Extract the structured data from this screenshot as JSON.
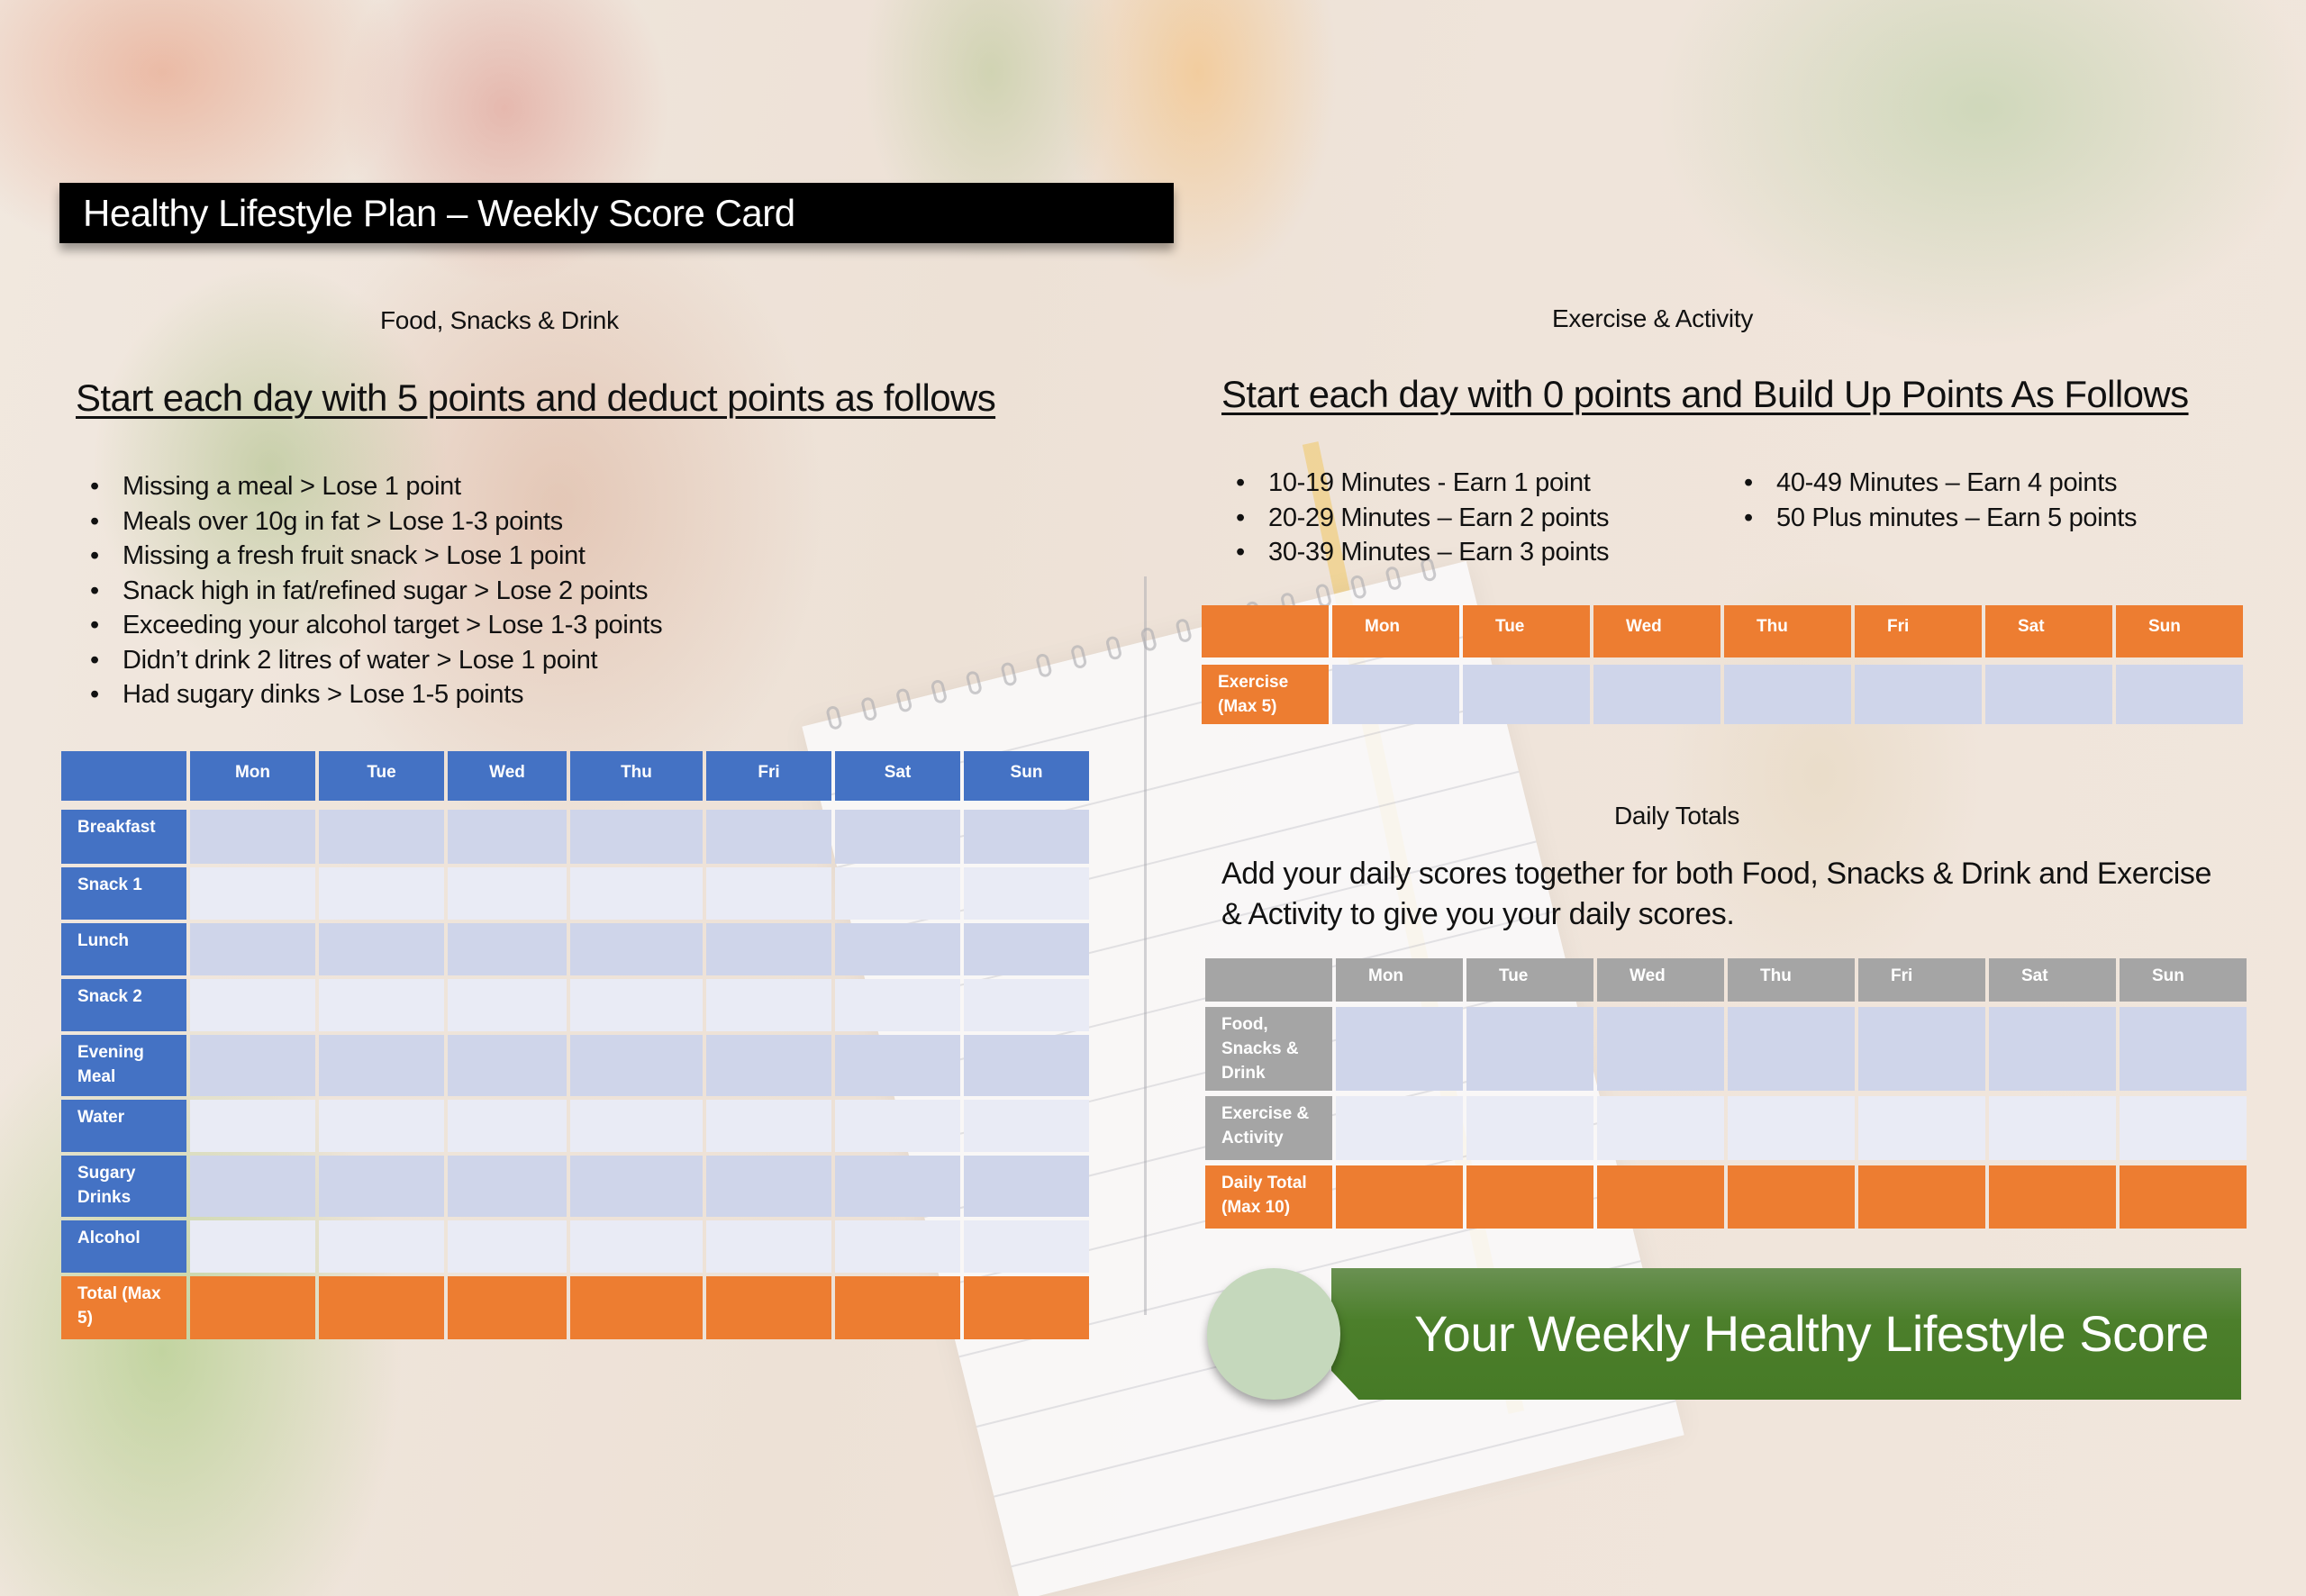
{
  "title": "Healthy Lifestyle Plan – Weekly Score Card",
  "colors": {
    "food_header": "#4472c4",
    "total_row": "#ed7d31",
    "exercise_header": "#ed7d31",
    "totals_header": "#a5a5a5",
    "band_dark": "#cfd5ea",
    "band_light": "#e9ebf5",
    "score_banner": "#4c7f2b",
    "score_circle": "#c5d8bc"
  },
  "food": {
    "caption": "Food, Snacks & Drink",
    "heading": "Start each day with 5 points and deduct points as follows",
    "rules": [
      "Missing a meal > Lose 1 point",
      "Meals over 10g in fat > Lose 1-3 points",
      "Missing a fresh fruit snack > Lose 1 point",
      "Snack high in fat/refined sugar > Lose 2 points",
      "Exceeding your alcohol target > Lose 1-3 points",
      "Didn’t drink 2 litres of water > Lose 1 point",
      "Had sugary dinks > Lose 1-5 points"
    ],
    "table": {
      "days": [
        "Mon",
        "Tue",
        "Wed",
        "Thu",
        "Fri",
        "Sat",
        "Sun"
      ],
      "rows": [
        {
          "label": "Breakfast",
          "values": [
            "",
            "",
            "",
            "",
            "",
            "",
            ""
          ]
        },
        {
          "label": "Snack 1",
          "values": [
            "",
            "",
            "",
            "",
            "",
            "",
            ""
          ]
        },
        {
          "label": "Lunch",
          "values": [
            "",
            "",
            "",
            "",
            "",
            "",
            ""
          ]
        },
        {
          "label": "Snack 2",
          "values": [
            "",
            "",
            "",
            "",
            "",
            "",
            ""
          ]
        },
        {
          "label": "Evening Meal",
          "values": [
            "",
            "",
            "",
            "",
            "",
            "",
            ""
          ]
        },
        {
          "label": "Water",
          "values": [
            "",
            "",
            "",
            "",
            "",
            "",
            ""
          ]
        },
        {
          "label": "Sugary Drinks",
          "values": [
            "",
            "",
            "",
            "",
            "",
            "",
            ""
          ]
        },
        {
          "label": "Alcohol",
          "values": [
            "",
            "",
            "",
            "",
            "",
            "",
            ""
          ]
        }
      ],
      "total_row": {
        "label": "Total (Max 5)",
        "values": [
          "",
          "",
          "",
          "",
          "",
          "",
          ""
        ]
      }
    }
  },
  "exercise": {
    "caption": "Exercise & Activity",
    "heading": "Start each day with 0 points and Build Up Points As Follows",
    "rules_col1": [
      "10-19 Minutes - Earn 1 point",
      "20-29 Minutes – Earn 2 points",
      "30-39 Minutes – Earn 3 points"
    ],
    "rules_col2": [
      "40-49 Minutes – Earn 4 points",
      "50 Plus minutes – Earn 5 points"
    ],
    "table": {
      "days": [
        "Mon",
        "Tue",
        "Wed",
        "Thu",
        "Fri",
        "Sat",
        "Sun"
      ],
      "row": {
        "label": "Exercise (Max 5)",
        "values": [
          "",
          "",
          "",
          "",
          "",
          "",
          ""
        ]
      }
    }
  },
  "daily_totals": {
    "caption": "Daily Totals",
    "description": "Add your daily scores together for both Food, Snacks & Drink and Exercise & Activity to give you your daily scores.",
    "table": {
      "days": [
        "Mon",
        "Tue",
        "Wed",
        "Thu",
        "Fri",
        "Sat",
        "Sun"
      ],
      "rows": [
        {
          "label": "Food, Snacks & Drink",
          "values": [
            "",
            "",
            "",
            "",
            "",
            "",
            ""
          ]
        },
        {
          "label": "Exercise & Activity",
          "values": [
            "",
            "",
            "",
            "",
            "",
            "",
            ""
          ]
        }
      ],
      "total_row": {
        "label": "Daily Total (Max 10)",
        "values": [
          "",
          "",
          "",
          "",
          "",
          "",
          ""
        ]
      }
    }
  },
  "weekly_score": {
    "label": "Your Weekly Healthy Lifestyle Score",
    "value": ""
  }
}
